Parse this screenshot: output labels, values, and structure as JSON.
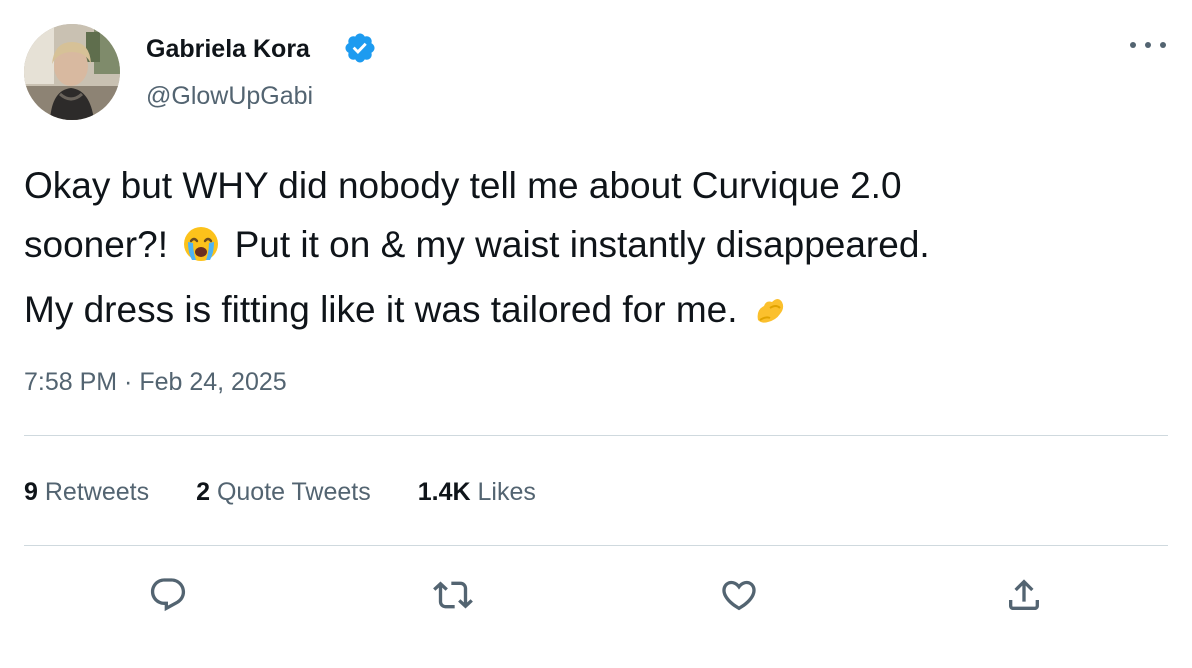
{
  "author": {
    "display_name": "Gabriela Kora",
    "handle": "@GlowUpGabi",
    "verified": true,
    "avatar_icon": "profile-photo"
  },
  "tweet": {
    "lines": [
      {
        "before": "Okay but WHY did nobody tell me about Curvique 2.0",
        "emoji": "",
        "after": ""
      },
      {
        "before": "sooner?!",
        "emoji": "loudly-crying-face",
        "after": "Put it on & my waist instantly disappeared."
      },
      {
        "before": "My dress is fitting like it was tailored for me.",
        "emoji": "pinched-fingers",
        "after": ""
      }
    ],
    "timestamp": "7:58 PM · Feb 24, 2025"
  },
  "stats": {
    "retweets_count": "9",
    "retweets_label": "Retweets",
    "quotes_count": "2",
    "quotes_label": "Quote Tweets",
    "likes_count": "1.4K",
    "likes_label": "Likes"
  },
  "actions": [
    "reply",
    "retweet",
    "like",
    "share"
  ],
  "colors": {
    "text": "#0f1419",
    "secondary": "#536471",
    "divider": "#cfd9de",
    "verified": "#1d9bf0"
  }
}
